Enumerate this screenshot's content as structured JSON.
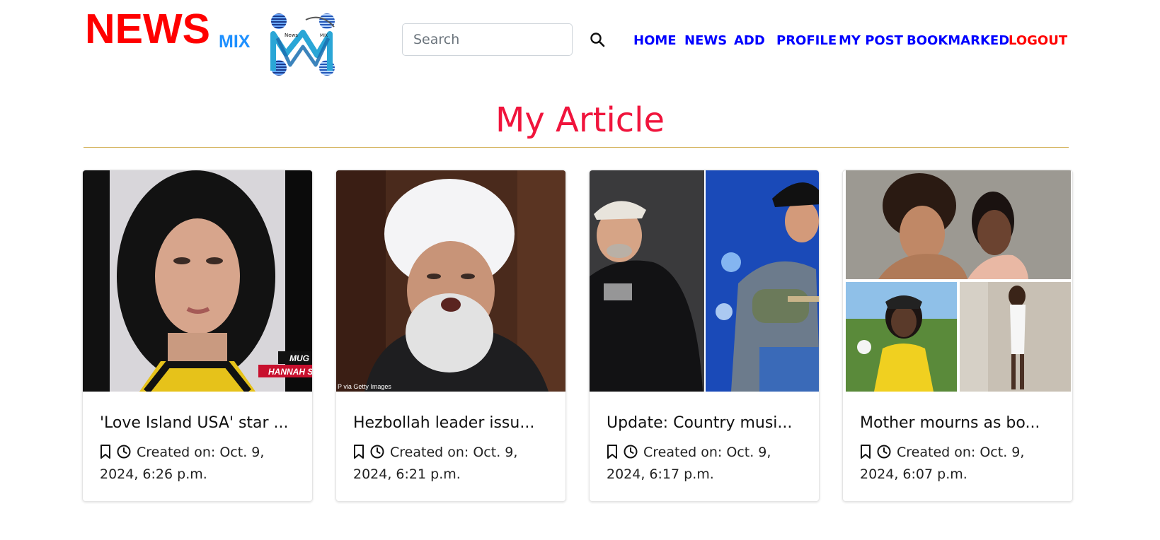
{
  "brand": {
    "news": "NEWS",
    "mix": "MIX",
    "logo_icon": "newsmix-logo-icon"
  },
  "search": {
    "placeholder": "Search",
    "value": "",
    "icon": "search-icon"
  },
  "nav": {
    "items": [
      {
        "label": "HOME"
      },
      {
        "label": "NEWS"
      },
      {
        "label": "ADD"
      },
      {
        "label": "PROFILE"
      },
      {
        "label": "MY POST"
      },
      {
        "label": "BOOKMARKED"
      },
      {
        "label": "LOGOUT"
      }
    ],
    "link_color": "#0000ff",
    "logout_color": "#ff0000"
  },
  "page": {
    "title": "My Article",
    "title_color": "#f0143c",
    "rule_color": "#d4b25a"
  },
  "cards": [
    {
      "title": "'Love Island USA' star ...",
      "created": "Created on: Oct. 9, 2024, 6:26 p.m.",
      "image": "mugshot-photo",
      "caption_lines": [
        "MUG",
        "HANNAH S"
      ]
    },
    {
      "title": "Hezbollah leader issu...",
      "created": "Created on: Oct. 9, 2024, 6:21 p.m.",
      "image": "cleric-speaking-photo",
      "caption_lines": [
        "P via Getty Images"
      ]
    },
    {
      "title": "Update: Country musi...",
      "created": "Created on: Oct. 9, 2024, 6:17 p.m.",
      "image": "country-singer-collage-photo",
      "caption_lines": []
    },
    {
      "title": "Mother mourns as bo...",
      "created": "Created on: Oct. 9, 2024, 6:07 p.m.",
      "image": "young-woman-collage-photo",
      "caption_lines": []
    }
  ]
}
